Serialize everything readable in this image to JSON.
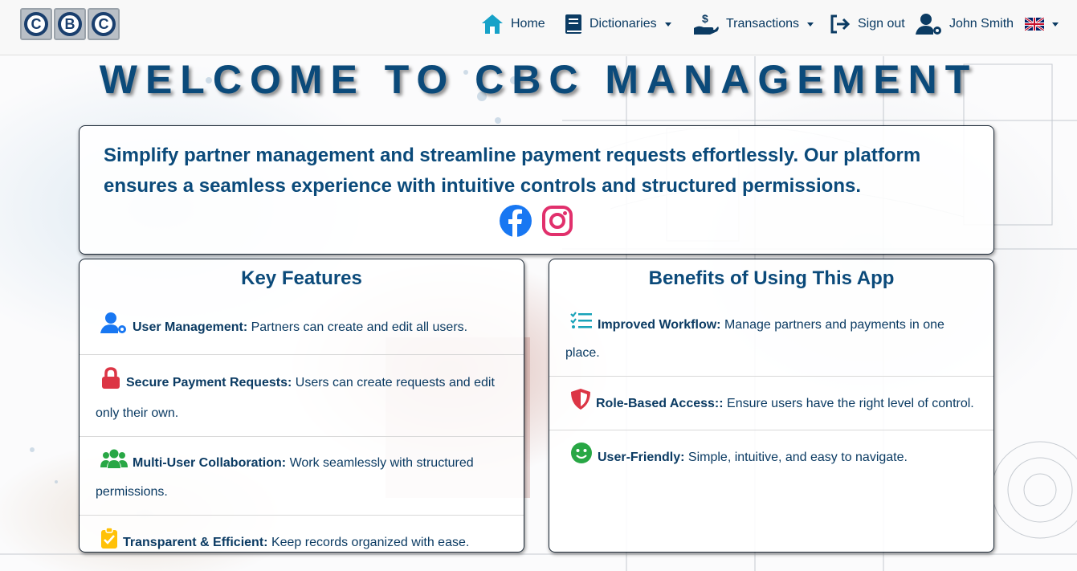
{
  "brand": {
    "logo_letters": [
      "C",
      "B",
      "C"
    ]
  },
  "nav": {
    "home": "Home",
    "dictionaries": "Dictionaries",
    "transactions": "Transactions",
    "sign_out": "Sign out",
    "user": "John Smith",
    "language_icon": "uk-flag-icon"
  },
  "hero": {
    "title": "WELCOME TO CBC MANAGEMENT",
    "intro": "Simplify partner management and streamline payment requests effortlessly. Our platform ensures a seamless experience with intuitive controls and structured permissions."
  },
  "features": {
    "title": "Key Features",
    "items": [
      {
        "icon": "user-gear-icon",
        "title": "User Management:",
        "text": "Partners can create and edit all users."
      },
      {
        "icon": "lock-icon",
        "title": "Secure Payment Requests:",
        "text": "Users can create requests and edit only their own."
      },
      {
        "icon": "users-icon",
        "title": "Multi-User Collaboration:",
        "text": "Work seamlessly with structured permissions."
      },
      {
        "icon": "clipboard-check-icon",
        "title": "Transparent & Efficient:",
        "text": "Keep records organized with ease."
      }
    ]
  },
  "benefits": {
    "title": "Benefits of Using This App",
    "items": [
      {
        "icon": "checklist-icon",
        "title": "Improved Workflow:",
        "text": "Manage partners and payments in one place."
      },
      {
        "icon": "shield-icon",
        "title": "Role-Based Access::",
        "text": "Ensure users have the right level of control."
      },
      {
        "icon": "smile-icon",
        "title": "User-Friendly:",
        "text": "Simple, intuitive, and easy to navigate."
      }
    ]
  },
  "colors": {
    "primary": "#0b3b63",
    "facebook": "#1877f2",
    "instagram": "#e1306c",
    "lock": "#dc3545",
    "users": "#28a745",
    "clipboard": "#ffc107",
    "checklist": "#17a2b8"
  }
}
